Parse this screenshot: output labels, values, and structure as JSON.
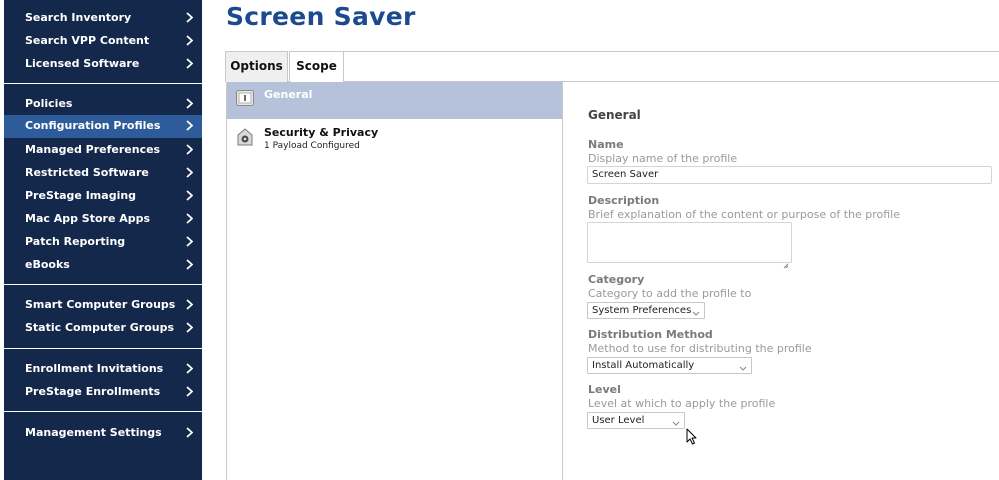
{
  "sidebar": {
    "items": [
      {
        "label": "Search Inventory"
      },
      {
        "label": "Search VPP Content"
      },
      {
        "label": "Licensed Software"
      },
      {
        "label": "Policies"
      },
      {
        "label": "Configuration Profiles",
        "active": true
      },
      {
        "label": "Managed Preferences"
      },
      {
        "label": "Restricted Software"
      },
      {
        "label": "PreStage Imaging"
      },
      {
        "label": "Mac App Store Apps"
      },
      {
        "label": "Patch Reporting"
      },
      {
        "label": "eBooks"
      },
      {
        "label": "Smart Computer Groups"
      },
      {
        "label": "Static Computer Groups"
      },
      {
        "label": "Enrollment Invitations"
      },
      {
        "label": "PreStage Enrollments"
      },
      {
        "label": "Management Settings"
      }
    ]
  },
  "page": {
    "title": "Screen Saver"
  },
  "tabs": [
    {
      "label": "Options"
    },
    {
      "label": "Scope"
    }
  ],
  "payloads": [
    {
      "title": "General",
      "icon": "general-icon"
    },
    {
      "title": "Security & Privacy",
      "subtitle": "1 Payload Configured",
      "icon": "security-icon"
    }
  ],
  "form": {
    "heading": "General",
    "name": {
      "label": "Name",
      "help": "Display name of the profile",
      "value": "Screen Saver"
    },
    "description": {
      "label": "Description",
      "help": "Brief explanation of the content or purpose of the profile",
      "value": ""
    },
    "category": {
      "label": "Category",
      "help": "Category to add the profile to",
      "value": "System Preferences"
    },
    "distribution": {
      "label": "Distribution Method",
      "help": "Method to use for distributing the profile",
      "value": "Install Automatically"
    },
    "level": {
      "label": "Level",
      "help": "Level at which to apply the profile",
      "value": "User Level"
    }
  },
  "colors": {
    "sidebar_bg": "#14284b",
    "sidebar_active": "#2e5c9a",
    "title": "#1d4a8e",
    "payload_selected": "#b5c2d9"
  }
}
